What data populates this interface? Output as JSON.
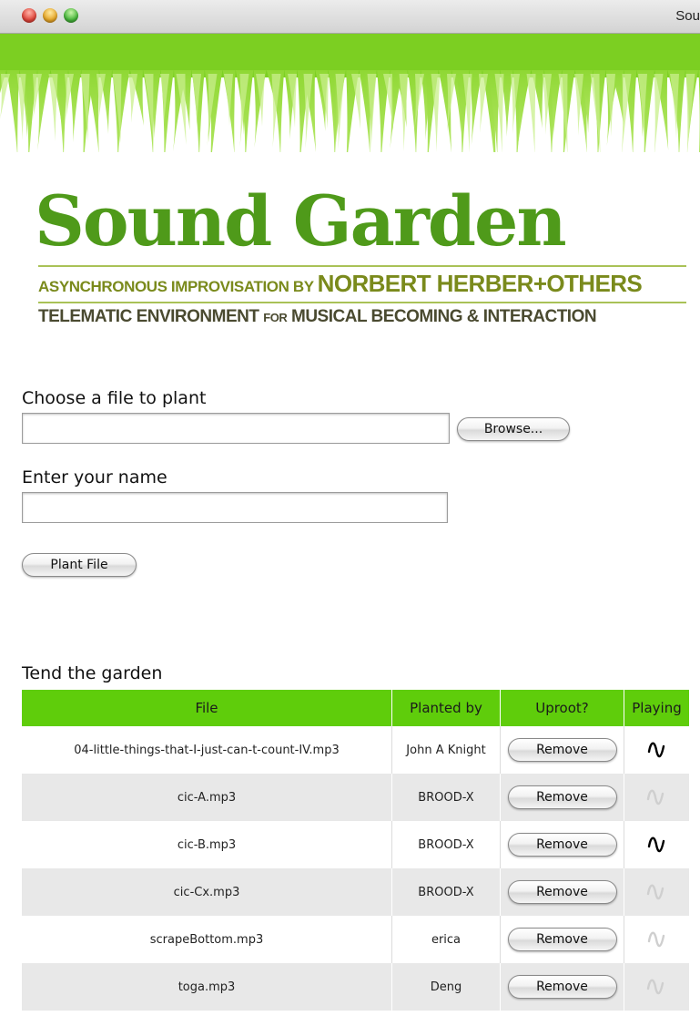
{
  "window": {
    "title": "Sou"
  },
  "logo": {
    "title": "Sound Garden",
    "subtitle1_part1": "ASYNCHRONOUS IMPROVISATION",
    "subtitle1_by": "BY",
    "subtitle1_part2": "NORBERT HERBER+OTHERS",
    "subtitle2_part1": "TELEMATIC ENVIRONMENT",
    "subtitle2_for": "FOR",
    "subtitle2_part2": "MUSICAL BECOMING & INTERACTION"
  },
  "form": {
    "file_label": "Choose a file to plant",
    "file_value": "",
    "browse_label": "Browse...",
    "name_label": "Enter your name",
    "name_value": "",
    "plant_label": "Plant File"
  },
  "garden": {
    "heading": "Tend the garden",
    "columns": [
      "File",
      "Planted by",
      "Uproot?",
      "Playing"
    ],
    "rows": [
      {
        "file": "04-little-things-that-I-just-can-t-count-IV.mp3",
        "planted_by": "John A Knight",
        "action": "Remove",
        "playing": true
      },
      {
        "file": "cic-A.mp3",
        "planted_by": "BROOD-X",
        "action": "Remove",
        "playing": false
      },
      {
        "file": "cic-B.mp3",
        "planted_by": "BROOD-X",
        "action": "Remove",
        "playing": true
      },
      {
        "file": "cic-Cx.mp3",
        "planted_by": "BROOD-X",
        "action": "Remove",
        "playing": false
      },
      {
        "file": "scrapeBottom.mp3",
        "planted_by": "erica",
        "action": "Remove",
        "playing": false
      },
      {
        "file": "toga.mp3",
        "planted_by": "Deng",
        "action": "Remove",
        "playing": false
      }
    ]
  },
  "colors": {
    "header_green": "#5fcd0b",
    "logo_green": "#4f9a1a",
    "row_alt": "#e8e8e8"
  },
  "icons": {
    "playing": "waveform-icon",
    "not_playing": "waveform-faded-icon"
  }
}
